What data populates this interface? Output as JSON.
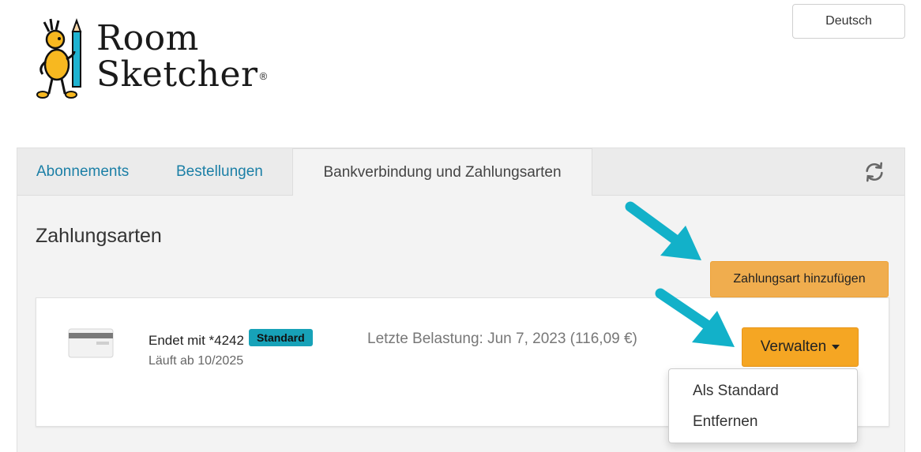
{
  "brand": {
    "line1": "Room",
    "line2": "Sketcher",
    "reg_mark": "®"
  },
  "header": {
    "language_button": "Deutsch"
  },
  "tabs": [
    {
      "label": "Abonnements",
      "active": false
    },
    {
      "label": "Bestellungen",
      "active": false
    },
    {
      "label": "Bankverbindung und Zahlungsarten",
      "active": true
    }
  ],
  "section": {
    "title": "Zahlungsarten",
    "add_button": "Zahlungsart hinzufügen"
  },
  "payment_method": {
    "ends_with": "Endet mit *4242",
    "badge": "Standard",
    "expires": "Läuft ab 10/2025",
    "last_charge": "Letzte Belastung: Jun 7, 2023 (116,09 €)",
    "manage_button": "Verwalten"
  },
  "manage_menu": {
    "items": [
      "Als Standard",
      "Entfernen"
    ]
  },
  "colors": {
    "link": "#1b7fa6",
    "add_button": "#f0ad4e",
    "manage_button": "#f5a623",
    "badge": "#17a2b8",
    "annotation_arrow": "#12b1c9"
  },
  "icons": {
    "refresh": "refresh-icon",
    "card": "credit-card-icon",
    "caret": "caret-down-icon"
  }
}
